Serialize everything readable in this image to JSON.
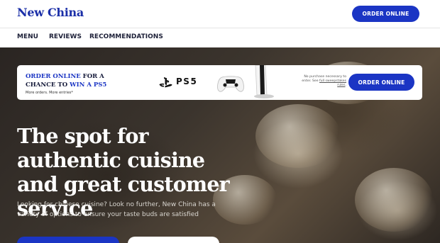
{
  "header": {
    "brand": "New China",
    "order_button": "ORDER ONLINE"
  },
  "nav": {
    "items": [
      {
        "label": "MENU"
      },
      {
        "label": "REVIEWS"
      },
      {
        "label": "RECOMMENDATIONS"
      }
    ]
  },
  "promo": {
    "line1_highlight": "ORDER ONLINE",
    "line1_rest": " FOR A",
    "line2_rest": "CHANCE TO ",
    "line2_highlight": "WIN A PS5",
    "line3": "More orders. More entries*",
    "ps_text": "PS5",
    "fine_print_1": "No purchase necessary to",
    "fine_print_2": "enter. See ",
    "fine_print_link": "full sweepstakes rules",
    "fine_print_3": ".",
    "order_button": "ORDER ONLINE"
  },
  "hero": {
    "headline": "The spot for authentic cuisine and great customer service",
    "subtext": "Looking for chinese cuisine? Look no further, New China has a variety of options to ensure your taste buds are satisfied"
  },
  "colors": {
    "brand_blue": "#1b35c4",
    "brand_text": "#1b2fa8",
    "dark_text": "#1d2038"
  },
  "icons": {
    "playstation": "playstation-logo-icon",
    "controller": "ps5-controller-icon",
    "console": "ps5-console-icon"
  }
}
